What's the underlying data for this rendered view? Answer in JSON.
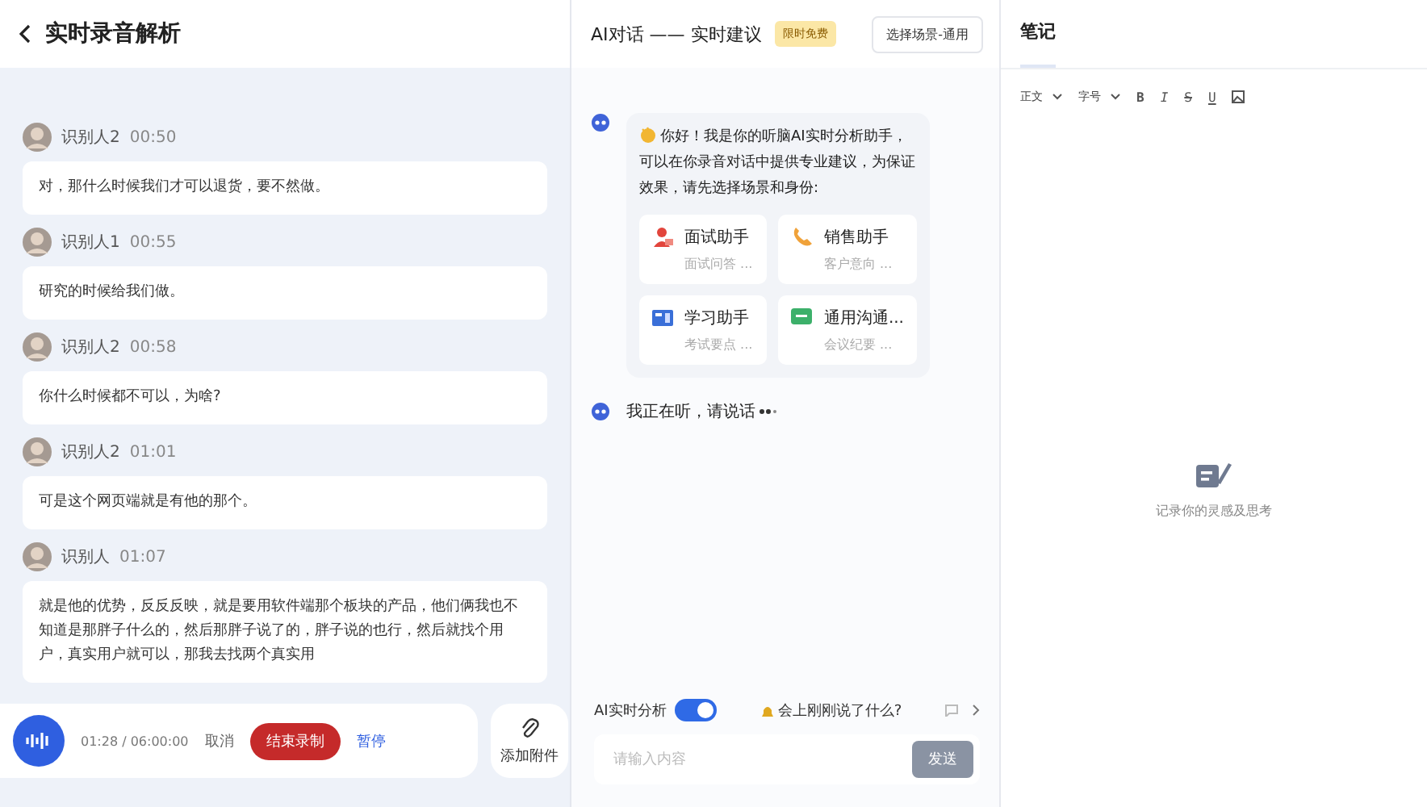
{
  "transcript": {
    "title": "实时录音解析",
    "entries": [
      {
        "speaker": "识别人2",
        "time": "00:50",
        "text": "对，那什么时候我们才可以退货，要不然做。"
      },
      {
        "speaker": "识别人1",
        "time": "00:55",
        "text": "研究的时候给我们做。"
      },
      {
        "speaker": "识别人2",
        "time": "00:58",
        "text": "你什么时候都不可以，为啥?"
      },
      {
        "speaker": "识别人2",
        "time": "01:01",
        "text": "可是这个网页端就是有他的那个。"
      },
      {
        "speaker": "识别人",
        "time": "01:07",
        "text": "就是他的优势，反反反映，就是要用软件端那个板块的产品，他们俩我也不知道是那胖子什么的，然后那胖子说了的，胖子说的也行，然后就找个用户，真实用户就可以，那我去找两个真实用"
      }
    ]
  },
  "recorder": {
    "time": "01:28 / 06:00:00",
    "cancel": "取消",
    "stop": "结束录制",
    "pause": "暂停"
  },
  "attach": {
    "label": "添加附件"
  },
  "ai": {
    "title": "AI对话 —— 实时建议",
    "badge": "限时免费",
    "scene_button": "选择场景-通用",
    "greeting": "你好！我是你的听脑AI实时分析助手，可以在你录音对话中提供专业建议，为保证效果，请先选择场景和身份:",
    "assistants": [
      {
        "kind": "interview",
        "title": "面试助手",
        "desc": "面试问答 ..."
      },
      {
        "kind": "sales",
        "title": "销售助手",
        "desc": "客户意向 ..."
      },
      {
        "kind": "study",
        "title": "学习助手",
        "desc": "考试要点 ..."
      },
      {
        "kind": "general",
        "title": "通用沟通...",
        "desc": "会议纪要 ..."
      }
    ],
    "listening": "我正在听，请说话",
    "realtime": {
      "label": "AI实时分析",
      "on": true
    },
    "suggestion": "会上刚刚说了什么?",
    "input": {
      "placeholder": "请输入内容"
    },
    "send": "发送"
  },
  "notes": {
    "title": "笔记",
    "toolbar": [
      {
        "kind": "dropdown",
        "label": "正文"
      },
      {
        "kind": "dropdown",
        "label": "字号"
      },
      {
        "kind": "bold",
        "label": "B"
      },
      {
        "kind": "italic",
        "label": "I"
      },
      {
        "kind": "strike",
        "label": "S"
      },
      {
        "kind": "underline",
        "label": "U"
      },
      {
        "kind": "image"
      }
    ],
    "empty": "记录你的灵感及思考"
  }
}
